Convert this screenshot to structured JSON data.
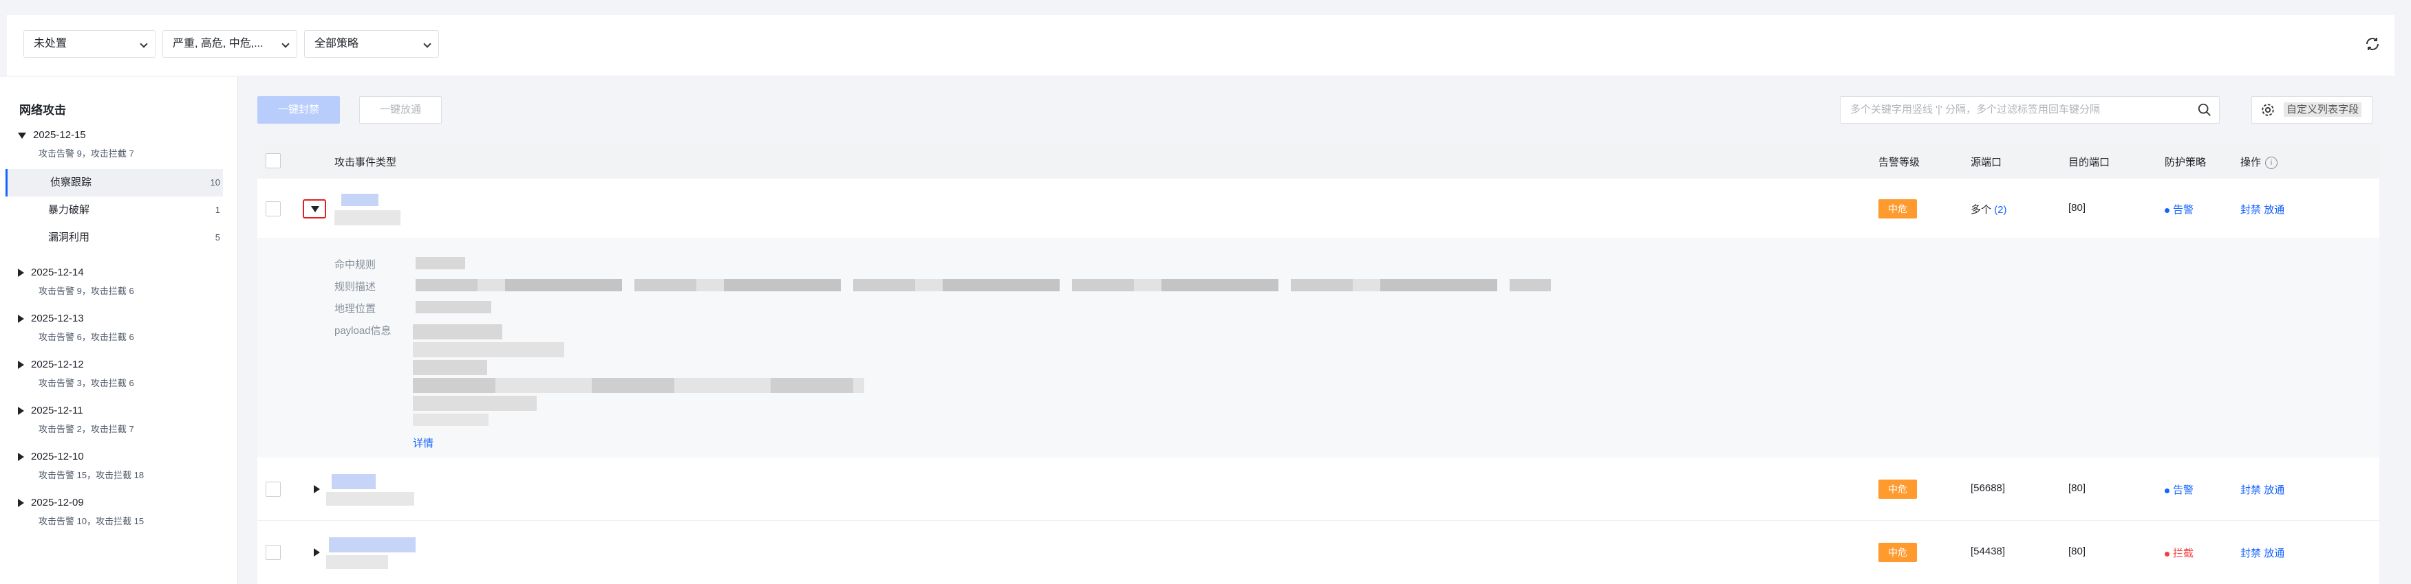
{
  "filters": {
    "status": "未处置",
    "severity": "严重, 高危, 中危,...",
    "policy": "全部策略"
  },
  "sidebar": {
    "title": "网络攻击",
    "days": [
      {
        "date": "2025-12-15",
        "summary": "攻击告警 9，攻击拦截 7",
        "expanded": true
      },
      {
        "date": "2025-12-14",
        "summary": "攻击告警 9，攻击拦截 6"
      },
      {
        "date": "2025-12-13",
        "summary": "攻击告警 6，攻击拦截 6"
      },
      {
        "date": "2025-12-12",
        "summary": "攻击告警 3，攻击拦截 6"
      },
      {
        "date": "2025-12-11",
        "summary": "攻击告警 2，攻击拦截 7"
      },
      {
        "date": "2025-12-10",
        "summary": "攻击告警 15，攻击拦截 18"
      },
      {
        "date": "2025-12-09",
        "summary": "攻击告警 10，攻击拦截 15"
      }
    ],
    "categories": [
      {
        "label": "侦察跟踪",
        "count": "10"
      },
      {
        "label": "暴力破解",
        "count": "1"
      },
      {
        "label": "漏洞利用",
        "count": "5"
      }
    ]
  },
  "toolbar": {
    "block_all": "一键封禁",
    "allow_all": "一键放通",
    "search_placeholder": "多个关键字用竖线 '|' 分隔，多个过滤标签用回车键分隔",
    "custom_fields": "自定义列表字段"
  },
  "table": {
    "headers": {
      "type": "攻击事件类型",
      "level": "告警等级",
      "src_port": "源端口",
      "dst_port": "目的端口",
      "policy": "防护策略",
      "action": "操作"
    },
    "rows": [
      {
        "level": "中危",
        "src_port_prefix": "多个",
        "src_port_count": "(2)",
        "dst_port": "[80]",
        "policy": "告警",
        "policy_color": "#1664ff",
        "block": "封禁",
        "allow": "放通"
      },
      {
        "level": "中危",
        "src_port": "[56688]",
        "dst_port": "[80]",
        "policy": "告警",
        "policy_color": "#1664ff",
        "block": "封禁",
        "allow": "放通"
      },
      {
        "level": "中危",
        "src_port": "[54438]",
        "dst_port": "[80]",
        "policy": "拦截",
        "policy_color": "#f53f3f",
        "block": "封禁",
        "allow": "放通"
      }
    ],
    "detail": {
      "hit_rule": "命中规则",
      "rule_desc": "规则描述",
      "location": "地理位置",
      "payload": "payload信息",
      "more": "详情"
    }
  },
  "colors": {
    "accent": "#1664ff",
    "warning": "#ff9a2e",
    "danger": "#f53f3f"
  }
}
